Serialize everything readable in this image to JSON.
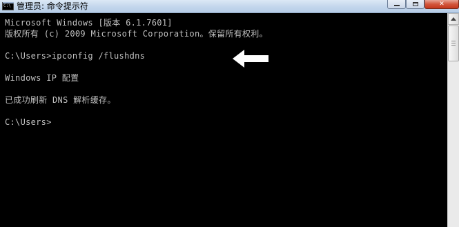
{
  "window": {
    "title": "管理员: 命令提示符",
    "icon": "cmd-icon",
    "icon_text": "C:\\",
    "close_glyph": "✕"
  },
  "console": {
    "lines": [
      "Microsoft Windows [版本 6.1.7601]",
      "版权所有 (c) 2009 Microsoft Corporation。保留所有权利。",
      "",
      "C:\\Users>ipconfig /flushdns",
      "",
      "Windows IP 配置",
      "",
      "已成功刷新 DNS 解析缓存。",
      "",
      "C:\\Users>"
    ],
    "text_color": "#c0c0c0",
    "background": "#000000"
  },
  "annotation": {
    "icon": "left-arrow-icon",
    "color": "#ffffff"
  }
}
